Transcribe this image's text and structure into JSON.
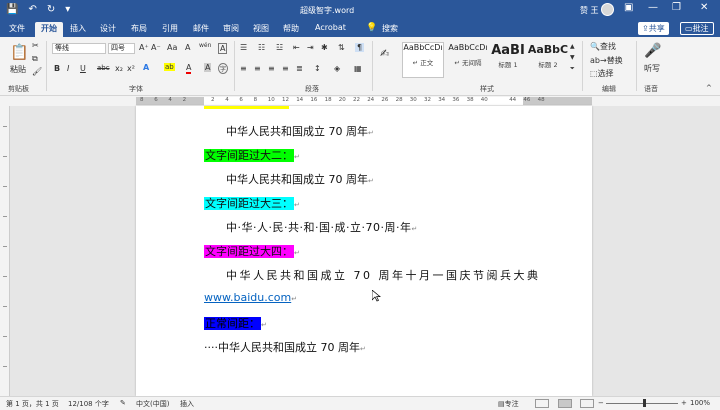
{
  "titlebar": {
    "doc_title": "超级智字.word",
    "user": "赞 王",
    "controls": {
      "minimize": "—",
      "restore": "❐",
      "close": "✕"
    }
  },
  "tabs": {
    "file": "文件",
    "home": "开始",
    "insert": "插入",
    "design": "设计",
    "layout": "布局",
    "references": "引用",
    "mailings": "邮件",
    "review": "审阅",
    "view": "视图",
    "help": "帮助",
    "acrobat": "Acrobat",
    "search": "搜索",
    "share": "共享",
    "comment": "批注"
  },
  "ribbon": {
    "clipboard": {
      "paste": "粘贴",
      "label": "剪贴板"
    },
    "font": {
      "name": "等线",
      "size": "四号",
      "label": "字体",
      "bold": "B",
      "italic": "I",
      "underline": "U",
      "strike": "abc",
      "sub": "x₂",
      "sup": "x²",
      "grow": "A⁺",
      "shrink": "A⁻",
      "case": "Aa",
      "clear": "A",
      "phonetic": "wén",
      "border": "A",
      "effects": "A",
      "highlight": "ab",
      "color": "A",
      "shade": "A",
      "encircle": "字"
    },
    "paragraph": {
      "label": "段落"
    },
    "styles": {
      "label": "样式",
      "items": [
        {
          "preview": "AaBbCcDı",
          "name": "↵ 正文"
        },
        {
          "preview": "AaBbCcDı",
          "name": "↵ 无间隔"
        },
        {
          "preview": "AaBI",
          "name": "标题 1"
        },
        {
          "preview": "AaBbC",
          "name": "标题 2"
        }
      ]
    },
    "editing": {
      "label": "编辑",
      "find": "查找",
      "replace": "替换",
      "select": "选择"
    },
    "voice": {
      "label": "语音",
      "dictate": "听写"
    }
  },
  "ruler": {
    "numbers": [
      "8",
      "6",
      "4",
      "2",
      "",
      "2",
      "4",
      "6",
      "8",
      "10",
      "12",
      "14",
      "16",
      "18",
      "20",
      "22",
      "24",
      "26",
      "28",
      "30",
      "32",
      "34",
      "36",
      "38",
      "40",
      "",
      "44",
      "46",
      "48"
    ]
  },
  "document": {
    "lines": [
      {
        "text": "中华人民共和国成立 70 周年",
        "mark": "↵",
        "highlight": ""
      },
      {
        "text": "文字间距过大二：",
        "mark": "↵",
        "highlight": "#00ff00"
      },
      {
        "text": "中华人民共和国成立 70 周年",
        "mark": "↵",
        "highlight": ""
      },
      {
        "text": "文字间距过大三：",
        "mark": "↵",
        "highlight": "#00ffff"
      },
      {
        "text": "中·华·人·民·共·和·国·成·立·70·周·年",
        "mark": "↵",
        "highlight": ""
      },
      {
        "text": "文字间距过大四：",
        "mark": "↵",
        "highlight": "#ff00ff"
      },
      {
        "text": "中华人民共和国成立 70 周年十月一国庆节阅兵大典",
        "mark": "",
        "highlight": ""
      },
      {
        "text": "www.baidu.com",
        "mark": "↵",
        "highlight": ""
      },
      {
        "text": "正常间距：",
        "mark": "↵",
        "highlight": "#0000ff"
      },
      {
        "text": "····中华人民共和国成立 70 周年",
        "mark": "↵",
        "highlight": ""
      }
    ]
  },
  "statusbar": {
    "page": "第 1 页，共 1 页",
    "words": "12/108 个字",
    "lang": "中文(中国)",
    "mode": "插入",
    "focus": "专注",
    "zoom": "100%",
    "zoom_minus": "−",
    "zoom_plus": "+"
  }
}
